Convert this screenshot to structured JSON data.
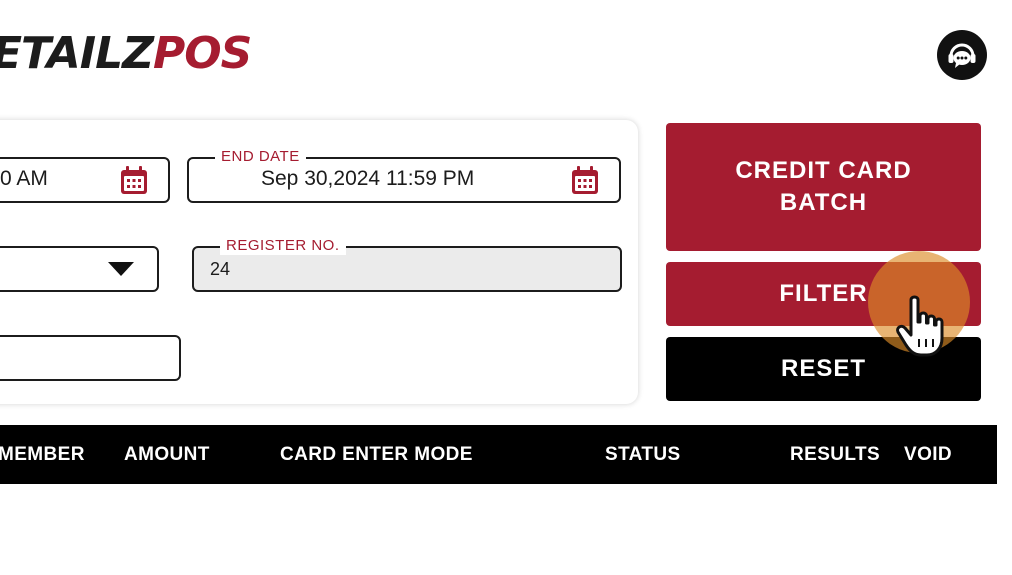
{
  "brand": {
    "logo_part1": "ETAILZ",
    "logo_part2": "POS"
  },
  "header": {
    "support_icon": "chat-headset-icon"
  },
  "filters": {
    "start_date_value": "0 AM",
    "end_date": {
      "label": "END DATE",
      "value": "Sep 30,2024 11:59 PM"
    },
    "dropdown_value": "",
    "register_no": {
      "label": "REGISTER NO.",
      "value": "24"
    },
    "text_input_value": ""
  },
  "actions": {
    "credit_card_batch": "CREDIT CARD\nBATCH",
    "filter": "FILTER",
    "reset": "RESET"
  },
  "table": {
    "columns": [
      "MEMBER",
      "AMOUNT",
      "CARD ENTER MODE",
      "STATUS",
      "RESULTS",
      "VOID"
    ]
  },
  "colors": {
    "accent": "#a51c30",
    "dark": "#000000",
    "highlight": "#dc8c28"
  }
}
